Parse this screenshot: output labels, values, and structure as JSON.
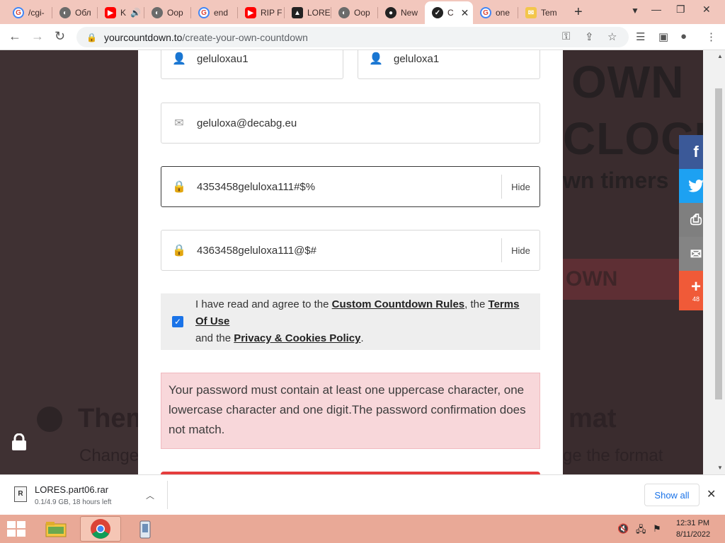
{
  "tabs": [
    {
      "title": "/cgi-",
      "favicon": "google-icon"
    },
    {
      "title": "Обл",
      "favicon": "opera-icon"
    },
    {
      "title": "K",
      "favicon": "youtube-icon"
    },
    {
      "title": "Oop",
      "favicon": "opera-icon"
    },
    {
      "title": "end",
      "favicon": "google-icon"
    },
    {
      "title": "RIP F",
      "favicon": "youtube-icon"
    },
    {
      "title": "LORE",
      "favicon": "drive-icon"
    },
    {
      "title": "Oop",
      "favicon": "opera-icon"
    },
    {
      "title": "New",
      "favicon": "github-icon"
    },
    {
      "title": "C",
      "favicon": "countdown-icon"
    },
    {
      "title": "one",
      "favicon": "google-icon"
    },
    {
      "title": "Tem",
      "favicon": "yahoo-icon"
    }
  ],
  "address": {
    "domain": "yourcountdown.to",
    "path": "/create-your-own-countdown"
  },
  "form": {
    "first_name": "geluloxau1",
    "last_name": "geluloxa1",
    "email": "geluloxa@decabg.eu",
    "password": "4353458geluloxa111#$%",
    "password_confirm": "4363458geluloxa111@$#",
    "hide_label": "Hide",
    "agree_prefix": "I have read and agree to the",
    "rules_link": "Custom Countdown Rules",
    "agree_mid": ", the",
    "terms_link": "Terms Of Use",
    "agree_and": "and the",
    "privacy_link": "Privacy & Cookies Policy",
    "agree_end": ".",
    "error": "Your password must contain at least one uppercase character, one lowercase character and one digit.The password confirmation does not match."
  },
  "background": {
    "hero_words": [
      "OWN",
      "CLOCK"
    ],
    "hero_sub": "wn timers",
    "hero_button": "OWN",
    "bottom_title": "Theme",
    "bottom_title_right": "mat",
    "bottom_sub": "Change",
    "bottom_sub_right": "ge the format"
  },
  "share": {
    "count": "48",
    "colors": {
      "facebook": "#3b5998",
      "twitter": "#1da1f2",
      "print": "#7f7f7f",
      "email": "#848484",
      "more": "#f05a38"
    }
  },
  "download": {
    "filename": "LORES.part06.rar",
    "status": "0.1/4.9 GB, 18 hours left",
    "show_all": "Show all"
  },
  "taskbar": {
    "time": "12:31 PM",
    "date": "8/11/2022"
  }
}
